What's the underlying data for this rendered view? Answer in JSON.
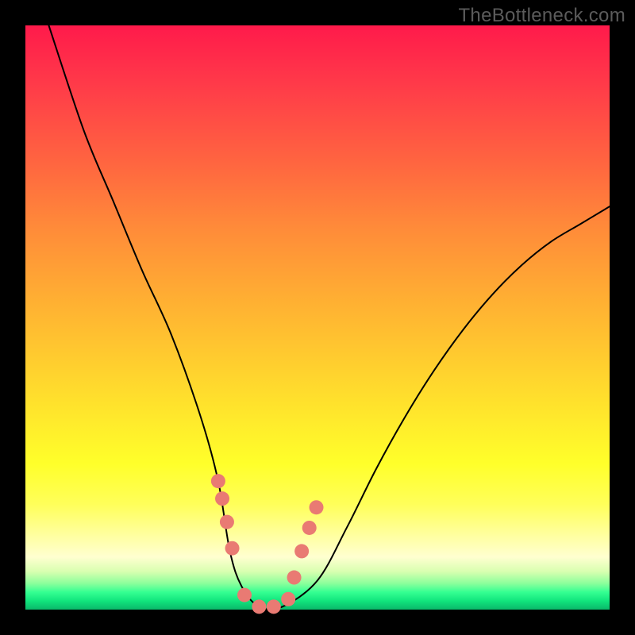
{
  "watermark": "TheBottleneck.com",
  "chart_data": {
    "type": "line",
    "title": "",
    "xlabel": "",
    "ylabel": "",
    "xlim": [
      0,
      100
    ],
    "ylim": [
      0,
      100
    ],
    "grid": false,
    "series": [
      {
        "name": "bottleneck-curve",
        "color": "#000000",
        "width": 2,
        "x": [
          4,
          10,
          15,
          20,
          25,
          30,
          33,
          35,
          37,
          40,
          44,
          50,
          55,
          60,
          65,
          70,
          75,
          80,
          85,
          90,
          95,
          100
        ],
        "y": [
          100,
          82,
          70,
          58,
          47,
          33,
          22,
          10,
          4,
          0.5,
          0.5,
          5,
          14,
          24,
          33,
          41,
          48,
          54,
          59,
          63,
          66,
          69
        ]
      },
      {
        "name": "highlight-dots",
        "color": "#e97a73",
        "type": "scatter",
        "size": 9,
        "x": [
          33.0,
          33.7,
          34.5,
          35.4,
          37.5,
          40.0,
          42.5,
          45.0,
          46.0,
          47.3,
          48.6,
          49.8
        ],
        "y": [
          22.0,
          19.0,
          15.0,
          10.5,
          2.5,
          0.5,
          0.5,
          1.8,
          5.5,
          10.0,
          14.0,
          17.5
        ]
      }
    ],
    "background_gradient": {
      "direction": "top-to-bottom",
      "stops": [
        {
          "offset": 0,
          "color": "#ff1a4b"
        },
        {
          "offset": 50,
          "color": "#ffb232"
        },
        {
          "offset": 75,
          "color": "#ffff2a"
        },
        {
          "offset": 96,
          "color": "#35ff92"
        },
        {
          "offset": 100,
          "color": "#0ab86a"
        }
      ]
    }
  }
}
